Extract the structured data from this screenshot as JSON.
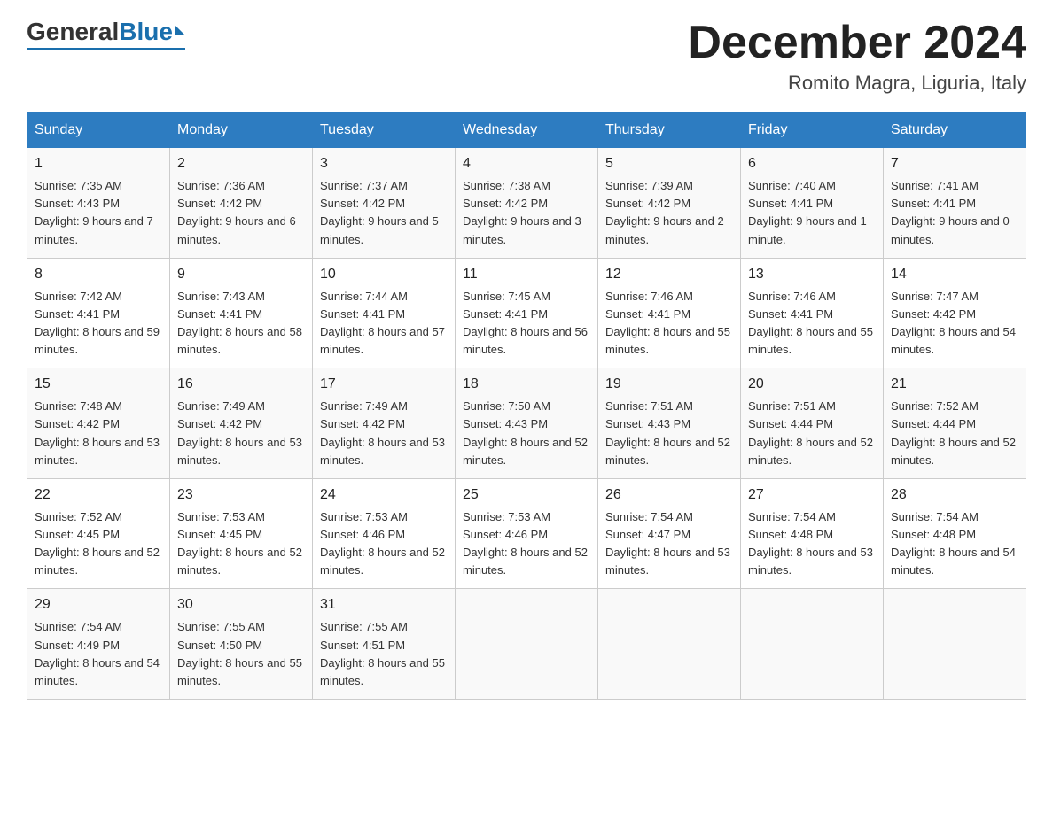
{
  "logo": {
    "general": "General",
    "blue": "Blue"
  },
  "header": {
    "month": "December 2024",
    "location": "Romito Magra, Liguria, Italy"
  },
  "weekdays": [
    "Sunday",
    "Monday",
    "Tuesday",
    "Wednesday",
    "Thursday",
    "Friday",
    "Saturday"
  ],
  "weeks": [
    [
      {
        "day": "1",
        "sunrise": "7:35 AM",
        "sunset": "4:43 PM",
        "daylight": "9 hours and 7 minutes."
      },
      {
        "day": "2",
        "sunrise": "7:36 AM",
        "sunset": "4:42 PM",
        "daylight": "9 hours and 6 minutes."
      },
      {
        "day": "3",
        "sunrise": "7:37 AM",
        "sunset": "4:42 PM",
        "daylight": "9 hours and 5 minutes."
      },
      {
        "day": "4",
        "sunrise": "7:38 AM",
        "sunset": "4:42 PM",
        "daylight": "9 hours and 3 minutes."
      },
      {
        "day": "5",
        "sunrise": "7:39 AM",
        "sunset": "4:42 PM",
        "daylight": "9 hours and 2 minutes."
      },
      {
        "day": "6",
        "sunrise": "7:40 AM",
        "sunset": "4:41 PM",
        "daylight": "9 hours and 1 minute."
      },
      {
        "day": "7",
        "sunrise": "7:41 AM",
        "sunset": "4:41 PM",
        "daylight": "9 hours and 0 minutes."
      }
    ],
    [
      {
        "day": "8",
        "sunrise": "7:42 AM",
        "sunset": "4:41 PM",
        "daylight": "8 hours and 59 minutes."
      },
      {
        "day": "9",
        "sunrise": "7:43 AM",
        "sunset": "4:41 PM",
        "daylight": "8 hours and 58 minutes."
      },
      {
        "day": "10",
        "sunrise": "7:44 AM",
        "sunset": "4:41 PM",
        "daylight": "8 hours and 57 minutes."
      },
      {
        "day": "11",
        "sunrise": "7:45 AM",
        "sunset": "4:41 PM",
        "daylight": "8 hours and 56 minutes."
      },
      {
        "day": "12",
        "sunrise": "7:46 AM",
        "sunset": "4:41 PM",
        "daylight": "8 hours and 55 minutes."
      },
      {
        "day": "13",
        "sunrise": "7:46 AM",
        "sunset": "4:41 PM",
        "daylight": "8 hours and 55 minutes."
      },
      {
        "day": "14",
        "sunrise": "7:47 AM",
        "sunset": "4:42 PM",
        "daylight": "8 hours and 54 minutes."
      }
    ],
    [
      {
        "day": "15",
        "sunrise": "7:48 AM",
        "sunset": "4:42 PM",
        "daylight": "8 hours and 53 minutes."
      },
      {
        "day": "16",
        "sunrise": "7:49 AM",
        "sunset": "4:42 PM",
        "daylight": "8 hours and 53 minutes."
      },
      {
        "day": "17",
        "sunrise": "7:49 AM",
        "sunset": "4:42 PM",
        "daylight": "8 hours and 53 minutes."
      },
      {
        "day": "18",
        "sunrise": "7:50 AM",
        "sunset": "4:43 PM",
        "daylight": "8 hours and 52 minutes."
      },
      {
        "day": "19",
        "sunrise": "7:51 AM",
        "sunset": "4:43 PM",
        "daylight": "8 hours and 52 minutes."
      },
      {
        "day": "20",
        "sunrise": "7:51 AM",
        "sunset": "4:44 PM",
        "daylight": "8 hours and 52 minutes."
      },
      {
        "day": "21",
        "sunrise": "7:52 AM",
        "sunset": "4:44 PM",
        "daylight": "8 hours and 52 minutes."
      }
    ],
    [
      {
        "day": "22",
        "sunrise": "7:52 AM",
        "sunset": "4:45 PM",
        "daylight": "8 hours and 52 minutes."
      },
      {
        "day": "23",
        "sunrise": "7:53 AM",
        "sunset": "4:45 PM",
        "daylight": "8 hours and 52 minutes."
      },
      {
        "day": "24",
        "sunrise": "7:53 AM",
        "sunset": "4:46 PM",
        "daylight": "8 hours and 52 minutes."
      },
      {
        "day": "25",
        "sunrise": "7:53 AM",
        "sunset": "4:46 PM",
        "daylight": "8 hours and 52 minutes."
      },
      {
        "day": "26",
        "sunrise": "7:54 AM",
        "sunset": "4:47 PM",
        "daylight": "8 hours and 53 minutes."
      },
      {
        "day": "27",
        "sunrise": "7:54 AM",
        "sunset": "4:48 PM",
        "daylight": "8 hours and 53 minutes."
      },
      {
        "day": "28",
        "sunrise": "7:54 AM",
        "sunset": "4:48 PM",
        "daylight": "8 hours and 54 minutes."
      }
    ],
    [
      {
        "day": "29",
        "sunrise": "7:54 AM",
        "sunset": "4:49 PM",
        "daylight": "8 hours and 54 minutes."
      },
      {
        "day": "30",
        "sunrise": "7:55 AM",
        "sunset": "4:50 PM",
        "daylight": "8 hours and 55 minutes."
      },
      {
        "day": "31",
        "sunrise": "7:55 AM",
        "sunset": "4:51 PM",
        "daylight": "8 hours and 55 minutes."
      },
      null,
      null,
      null,
      null
    ]
  ]
}
